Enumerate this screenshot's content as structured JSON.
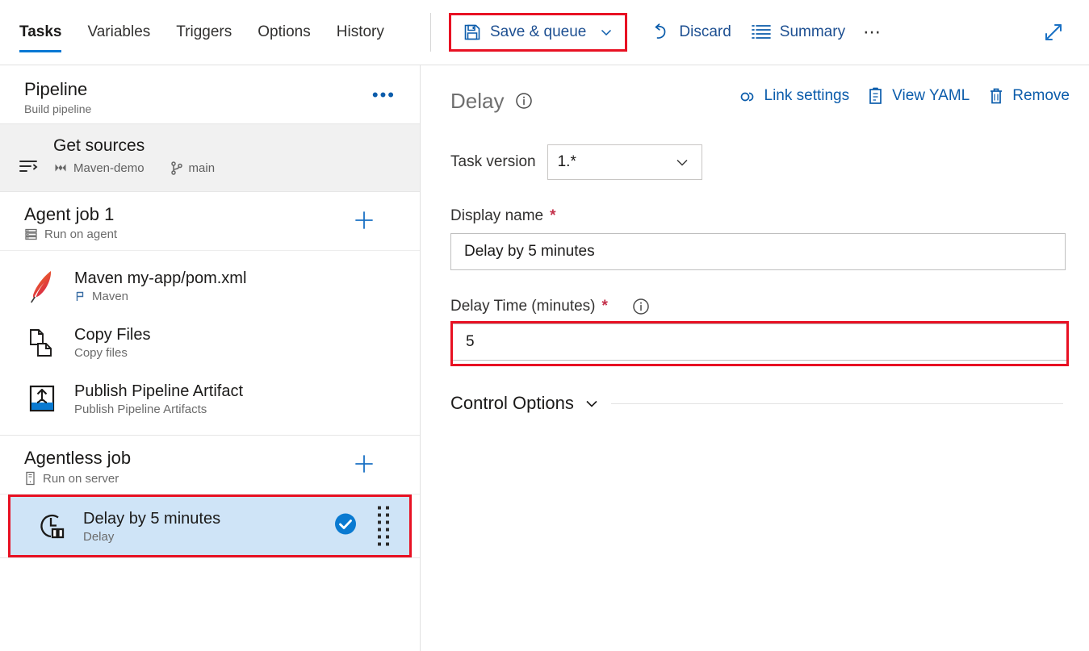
{
  "tabs": [
    {
      "label": "Tasks",
      "active": true
    },
    {
      "label": "Variables",
      "active": false
    },
    {
      "label": "Triggers",
      "active": false
    },
    {
      "label": "Options",
      "active": false
    },
    {
      "label": "History",
      "active": false
    }
  ],
  "toolbar": {
    "save_queue_label": "Save & queue",
    "save_icon": "save-floppy-icon",
    "save_chevron_icon": "chevron-down-icon",
    "discard_label": "Discard",
    "discard_icon": "undo-arrow-icon",
    "summary_label": "Summary",
    "summary_icon": "list-summary-icon",
    "overflow_label": "⋯",
    "expand_icon": "expand-diagonal-icon",
    "highlight_color": "#e81123",
    "link_color": "#0b5cab"
  },
  "pipeline": {
    "title": "Pipeline",
    "subtitle": "Build pipeline",
    "more_label": "•••"
  },
  "get_sources": {
    "title": "Get sources",
    "repo_icon": "azure-repos-icon",
    "repo": "Maven-demo",
    "branch_icon": "branch-icon",
    "branch": "main"
  },
  "jobs": [
    {
      "name": "agent-job-1",
      "title": "Agent job 1",
      "subtitle": "Run on agent",
      "sub_icon": "agent-server-icon",
      "add_icon": "plus-icon",
      "tasks": [
        {
          "title": "Maven my-app/pom.xml",
          "subtitle": "Maven",
          "icon": "maven-feather-icon",
          "sub_icon": "flag-icon",
          "selected": false
        },
        {
          "title": "Copy Files",
          "subtitle": "Copy files",
          "icon": "copy-files-icon",
          "sub_icon": "",
          "selected": false
        },
        {
          "title": "Publish Pipeline Artifact",
          "subtitle": "Publish Pipeline Artifacts",
          "icon": "publish-artifact-icon",
          "sub_icon": "",
          "selected": false
        }
      ]
    },
    {
      "name": "agentless-job",
      "title": "Agentless job",
      "subtitle": "Run on server",
      "sub_icon": "server-icon",
      "add_icon": "plus-icon",
      "tasks": [
        {
          "title": "Delay by 5 minutes",
          "subtitle": "Delay",
          "icon": "delay-clock-icon",
          "sub_icon": "",
          "selected": true,
          "status_icon": "check-circle-icon",
          "drag_icon": "drag-dots-icon"
        }
      ]
    }
  ],
  "detail": {
    "title": "Delay",
    "info_icon": "info-icon",
    "actions": [
      {
        "label": "Link settings",
        "icon": "link-settings-icon"
      },
      {
        "label": "View YAML",
        "icon": "view-yaml-icon"
      },
      {
        "label": "Remove",
        "icon": "trash-icon"
      }
    ],
    "task_version": {
      "label": "Task version",
      "value": "1.*",
      "chevron_icon": "chevron-down-icon"
    },
    "display_name": {
      "label": "Display name",
      "required": "*",
      "value": "Delay by 5 minutes"
    },
    "delay_time": {
      "label": "Delay Time (minutes)",
      "required": "*",
      "info_icon": "info-icon",
      "value": "5",
      "highlighted": true
    },
    "control_options": {
      "label": "Control Options",
      "chevron_icon": "chevron-down-icon",
      "expanded": false
    }
  }
}
